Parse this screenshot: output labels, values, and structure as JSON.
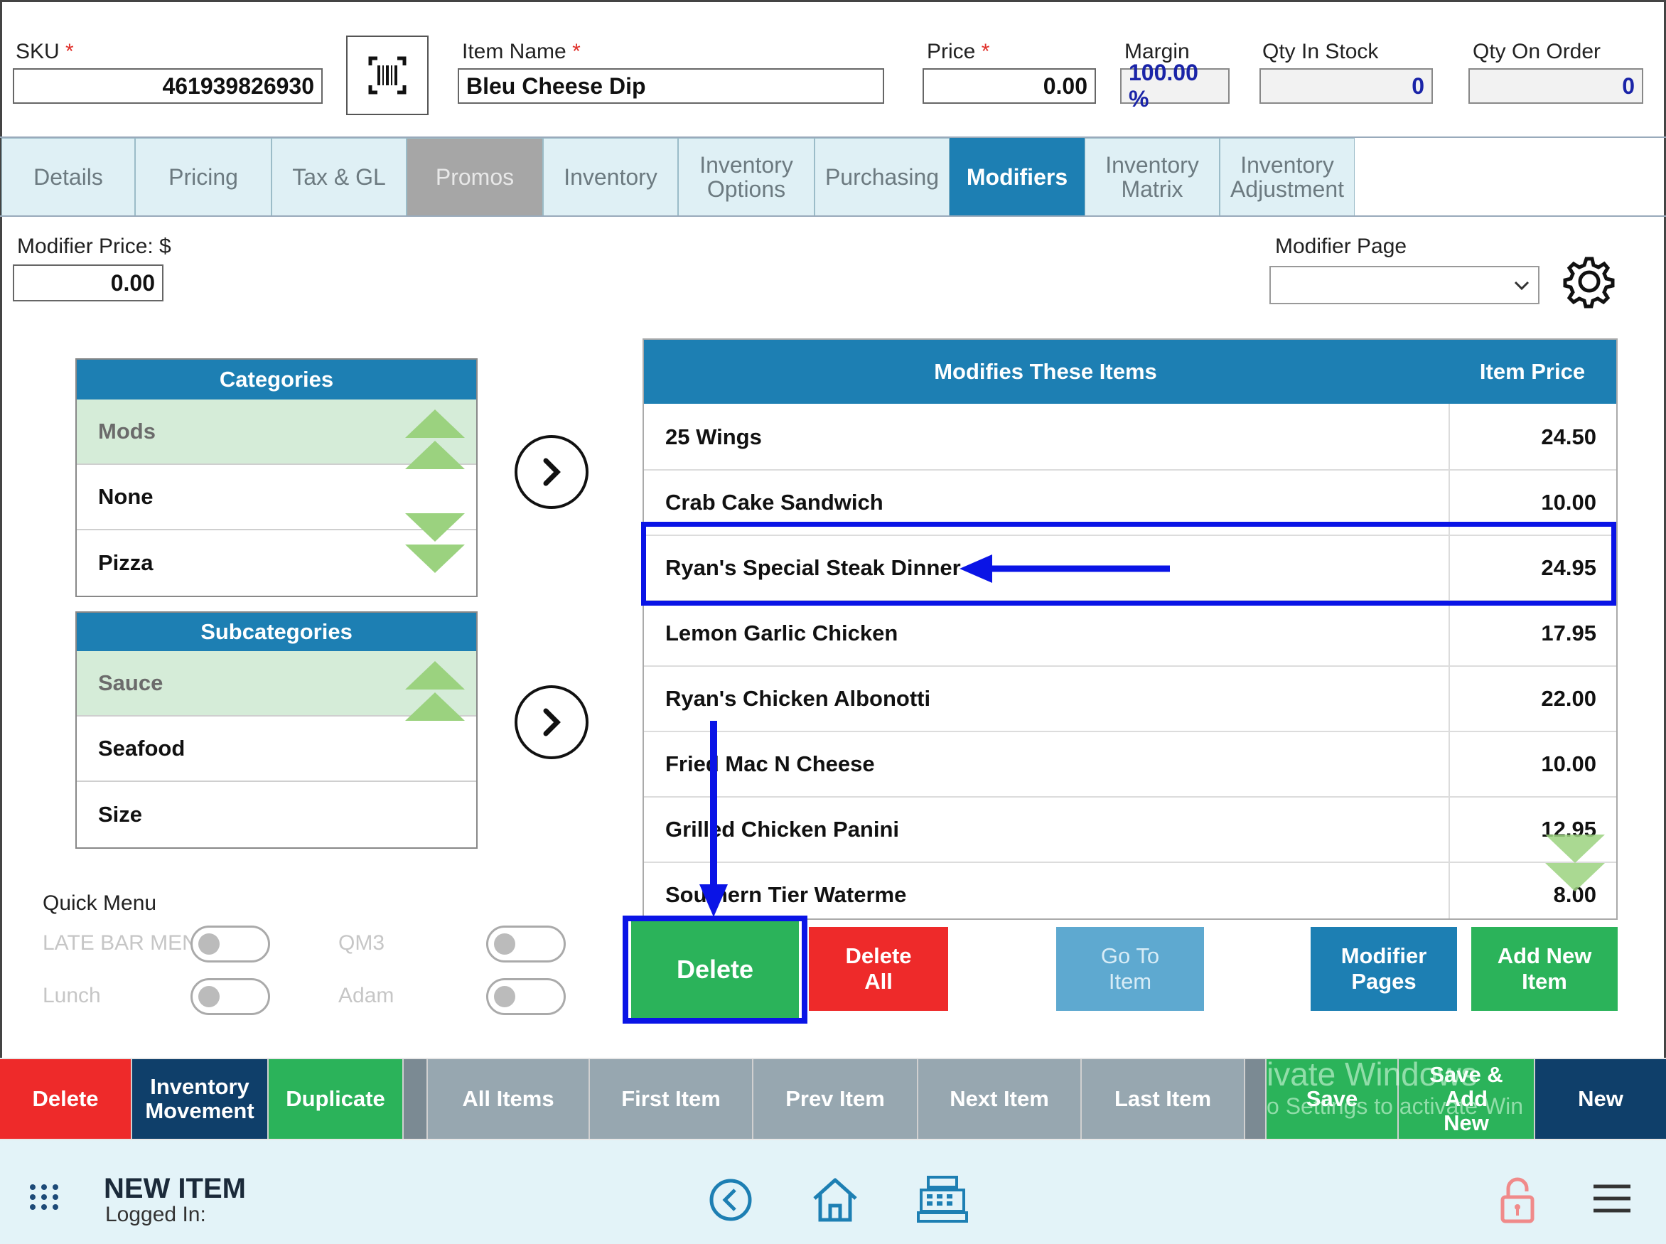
{
  "header": {
    "sku_label": "SKU",
    "sku_value": "461939826930",
    "item_name_label": "Item Name",
    "item_name_value": "Bleu Cheese Dip",
    "price_label": "Price",
    "price_value": "0.00",
    "margin_label": "Margin",
    "margin_value": "100.00 %",
    "qty_stock_label": "Qty In Stock",
    "qty_stock_value": "0",
    "qty_order_label": "Qty On Order",
    "qty_order_value": "0",
    "required_mark": "*"
  },
  "tabs": [
    {
      "label": "Details"
    },
    {
      "label": "Pricing"
    },
    {
      "label": "Tax & GL"
    },
    {
      "label": "Promos"
    },
    {
      "label": "Inventory"
    },
    {
      "label": "Inventory Options"
    },
    {
      "label": "Purchasing"
    },
    {
      "label": "Modifiers"
    },
    {
      "label": "Inventory Matrix"
    },
    {
      "label": "Inventory Adjustment"
    }
  ],
  "modifier_price": {
    "label": "Modifier Price: $",
    "value": "0.00"
  },
  "modifier_page": {
    "label": "Modifier Page",
    "value": ""
  },
  "categories": {
    "title": "Categories",
    "items": [
      "Mods",
      "None",
      "Pizza"
    ]
  },
  "subcategories": {
    "title": "Subcategories",
    "items": [
      "Sauce",
      "Seafood",
      "Size"
    ]
  },
  "modifies_table": {
    "title": "Modifies These Items",
    "price_header": "Item Price",
    "rows": [
      {
        "name": "25 Wings",
        "price": "24.50"
      },
      {
        "name": "Crab Cake Sandwich",
        "price": "10.00"
      },
      {
        "name": "Ryan's Special Steak Dinner",
        "price": "24.95"
      },
      {
        "name": "Lemon Garlic Chicken",
        "price": "17.95"
      },
      {
        "name": "Ryan's Chicken Albonotti",
        "price": "22.00"
      },
      {
        "name": "Fried Mac N Cheese",
        "price": "10.00"
      },
      {
        "name": "Grilled Chicken Panini",
        "price": "12.95"
      },
      {
        "name": "Southern Tier Waterme",
        "price": "8.00"
      }
    ]
  },
  "quick_menu": {
    "label": "Quick Menu",
    "options": [
      "LATE BAR MENU",
      "QM3",
      "Lunch",
      "Adam"
    ]
  },
  "action_buttons": {
    "delete": "Delete",
    "delete_all": "Delete All",
    "go_to_item": "Go To Item",
    "modifier_pages": "Modifier Pages",
    "add_new_item": "Add New Item"
  },
  "bottom_nav": {
    "delete": "Delete",
    "inventory_movement": "Inventory Movement",
    "duplicate": "Duplicate",
    "all_items": "All Items",
    "first_item": "First Item",
    "prev_item": "Prev Item",
    "next_item": "Next Item",
    "last_item": "Last Item",
    "save": "Save",
    "save_add_new": "Save & Add New",
    "new": "New"
  },
  "watermark": {
    "line1": "ivate Windows",
    "line2": "o Settings to activate Win"
  },
  "footer": {
    "title": "NEW ITEM",
    "logged_in": "Logged In:"
  },
  "colors": {
    "blue": "#1d7fb3",
    "green": "#2bb35a",
    "red": "#ee2a2a",
    "dark_blue": "#0f3f6a",
    "annotation": "#0a14e6"
  },
  "icons": [
    "barcode-icon",
    "gear-icon",
    "chevron-right-icon",
    "grid-icon",
    "back-icon",
    "home-icon",
    "register-icon",
    "lock-icon",
    "menu-icon"
  ]
}
